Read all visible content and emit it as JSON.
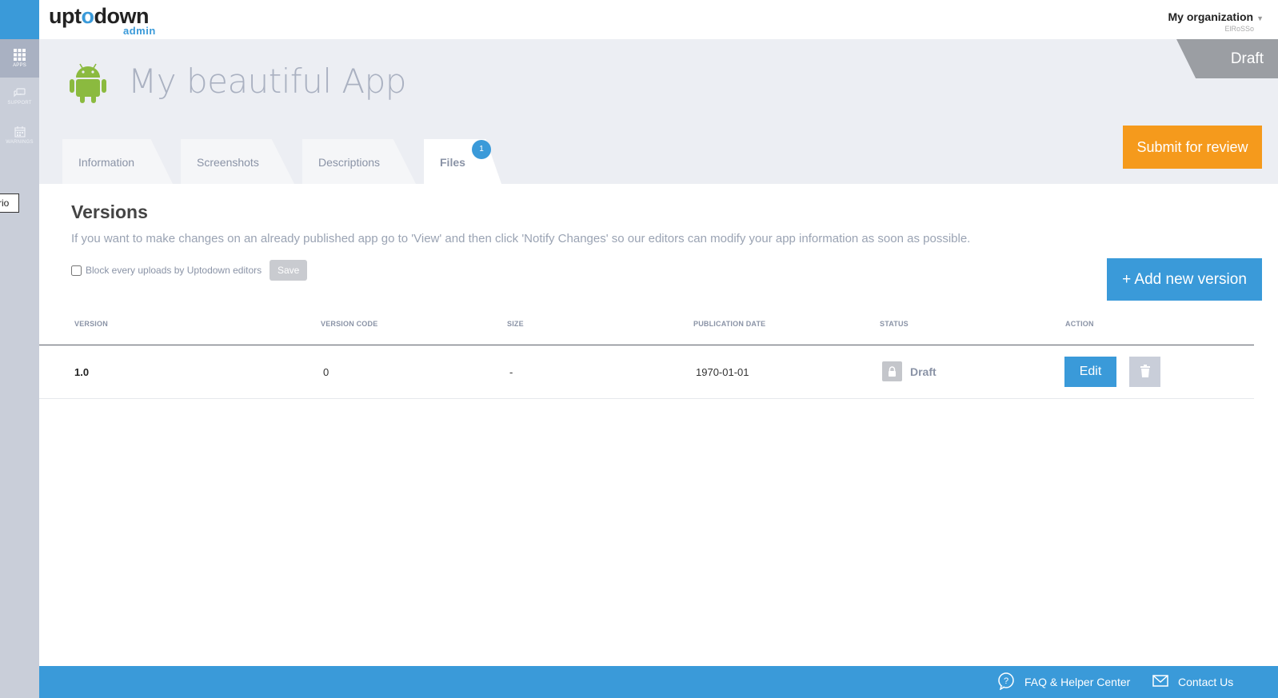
{
  "sidebar": {
    "items": [
      {
        "label": "APPS",
        "icon": "grid-icon",
        "active": true
      },
      {
        "label": "SUPPORT",
        "icon": "chat-icon",
        "active": false
      },
      {
        "label": "WARNINGS",
        "icon": "calendar-icon",
        "active": false
      }
    ],
    "tooltip": "rio"
  },
  "topbar": {
    "logo_prefix": "upt",
    "logo_o": "o",
    "logo_suffix": "down",
    "logo_sub": "admin",
    "org_name": "My organization",
    "org_user": "ElRoSSo"
  },
  "header": {
    "app_title": "My beautiful App",
    "status_ribbon": "Draft",
    "submit_label": "Submit for review",
    "tabs": [
      {
        "label": "Information"
      },
      {
        "label": "Screenshots"
      },
      {
        "label": "Descriptions"
      },
      {
        "label": "Files"
      }
    ],
    "files_badge": "1"
  },
  "versions": {
    "title": "Versions",
    "info": "If you want to make changes on an already published app go to 'View' and then click 'Notify Changes' so our editors can modify your app information as soon as possible.",
    "block_label": "Block every uploads by Uptodown editors",
    "save_label": "Save",
    "add_label": "+ Add new version",
    "columns": [
      "VERSION",
      "VERSION CODE",
      "SIZE",
      "PUBLICATION DATE",
      "STATUS",
      "ACTION"
    ],
    "rows": [
      {
        "version": "1.0",
        "code": "0",
        "size": "-",
        "date": "1970-01-01",
        "status": "Draft",
        "edit_label": "Edit"
      }
    ]
  },
  "footer": {
    "faq_label": "FAQ & Helper Center",
    "contact_label": "Contact Us"
  },
  "colors": {
    "accent": "#3a9ad9",
    "submit": "#f59a1c",
    "android": "#8bba3f"
  }
}
